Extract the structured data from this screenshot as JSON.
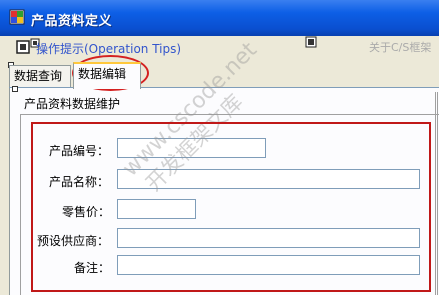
{
  "window": {
    "title": "产品资料定义",
    "accent": "#0d5fe6"
  },
  "toolbar": {
    "tips_label": "操作提示(Operation Tips)",
    "about_label": "关于C/S框架",
    "link_color": "#3355cc"
  },
  "tabs": [
    {
      "label": "数据查询",
      "active": false
    },
    {
      "label": "数据编辑",
      "active": true
    }
  ],
  "group": {
    "title": "产品资料数据维护"
  },
  "form": {
    "product_code": {
      "label": "产品编号：",
      "value": ""
    },
    "product_name": {
      "label": "产品名称：",
      "value": ""
    },
    "retail_price": {
      "label": "零售价：",
      "value": ""
    },
    "default_supplier": {
      "label": "预设供应商：",
      "value": ""
    },
    "remarks": {
      "label": "备注：",
      "value": ""
    }
  },
  "watermark": {
    "line1": "www.cscode.net",
    "line2": "开发框架文库"
  },
  "annotation_color": "#d42020"
}
